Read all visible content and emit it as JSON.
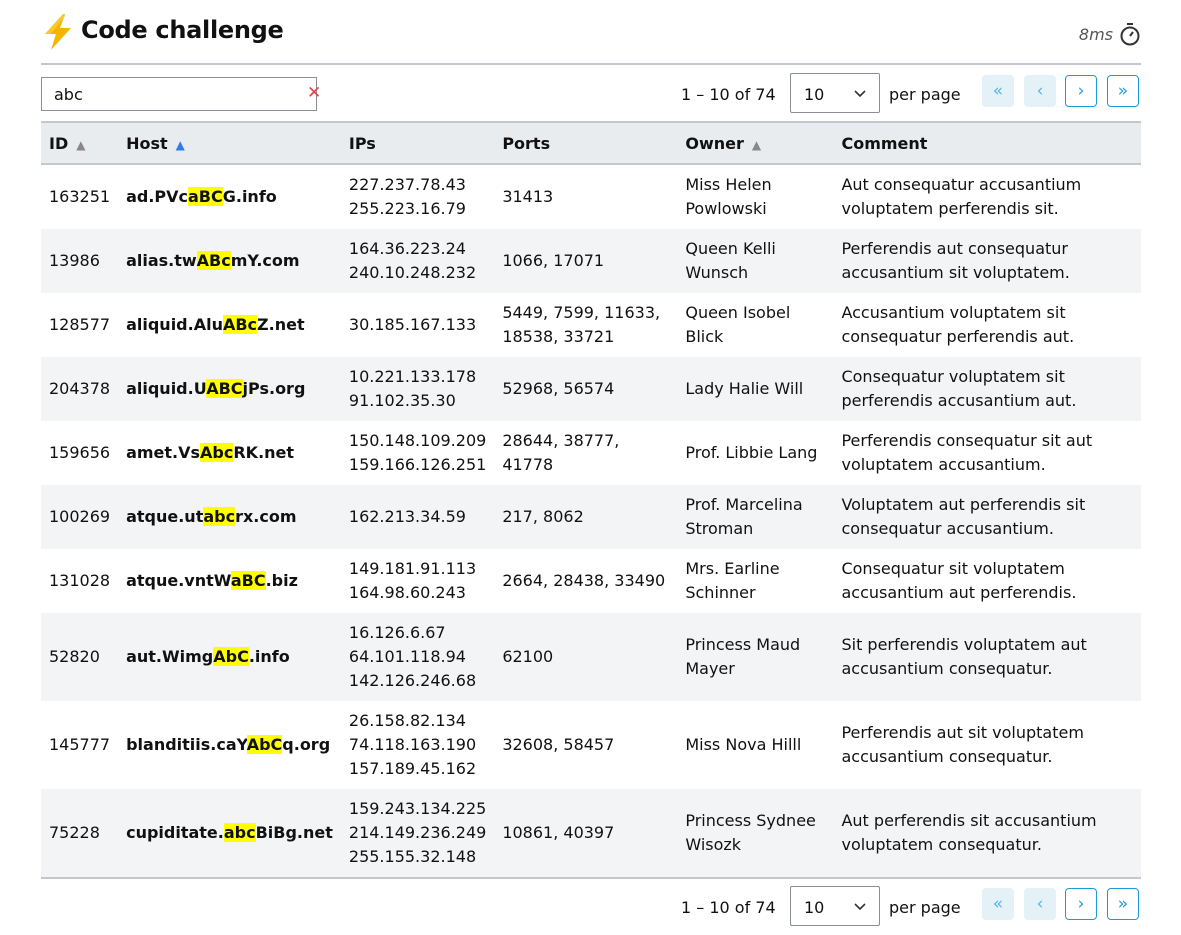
{
  "header": {
    "title": "Code challenge",
    "timing": "8ms"
  },
  "toolbar": {
    "search_value": "abc",
    "clear": "✕",
    "range": "1 – 10 of 74",
    "per_page_value": "10",
    "per_page_label": "per page",
    "first": "«",
    "prev": "‹",
    "next": "›",
    "last": "»"
  },
  "columns": [
    "ID",
    "Host",
    "IPs",
    "Ports",
    "Owner",
    "Comment"
  ],
  "rows": [
    {
      "id": "163251",
      "host_pre": "ad.PVc",
      "host_match": "aBC",
      "host_post": "G.info",
      "ips": [
        "227.237.78.43",
        "255.223.16.79"
      ],
      "ports": "31413",
      "owner": "Miss Helen Powlowski",
      "comment": "Aut consequatur accusantium voluptatem perferendis sit."
    },
    {
      "id": "13986",
      "host_pre": "alias.tw",
      "host_match": "ABc",
      "host_post": "mY.com",
      "ips": [
        "164.36.223.24",
        "240.10.248.232"
      ],
      "ports": "1066, 17071",
      "owner": "Queen Kelli Wunsch",
      "comment": "Perferendis aut consequatur accusantium sit voluptatem."
    },
    {
      "id": "128577",
      "host_pre": "aliquid.Alu",
      "host_match": "ABc",
      "host_post": "Z.net",
      "ips": [
        "30.185.167.133"
      ],
      "ports": "5449, 7599, 11633, 18538, 33721",
      "owner": "Queen Isobel Blick",
      "comment": "Accusantium voluptatem sit consequatur perferendis aut."
    },
    {
      "id": "204378",
      "host_pre": "aliquid.U",
      "host_match": "ABC",
      "host_post": "jPs.org",
      "ips": [
        "10.221.133.178",
        "91.102.35.30"
      ],
      "ports": "52968, 56574",
      "owner": "Lady Halie Will",
      "comment": "Consequatur voluptatem sit perferendis accusantium aut."
    },
    {
      "id": "159656",
      "host_pre": "amet.Vs",
      "host_match": "Abc",
      "host_post": "RK.net",
      "ips": [
        "150.148.109.209",
        "159.166.126.251"
      ],
      "ports": "28644, 38777, 41778",
      "owner": "Prof. Libbie Lang",
      "comment": "Perferendis consequatur sit aut voluptatem accusantium."
    },
    {
      "id": "100269",
      "host_pre": "atque.ut",
      "host_match": "abc",
      "host_post": "rx.com",
      "ips": [
        "162.213.34.59"
      ],
      "ports": "217, 8062",
      "owner": "Prof. Marcelina Stroman",
      "comment": "Voluptatem aut perferendis sit consequatur accusantium."
    },
    {
      "id": "131028",
      "host_pre": "atque.vntW",
      "host_match": "aBC",
      "host_post": ".biz",
      "ips": [
        "149.181.91.113",
        "164.98.60.243"
      ],
      "ports": "2664, 28438, 33490",
      "owner": "Mrs. Earline Schinner",
      "comment": "Consequatur sit voluptatem accusantium aut perferendis."
    },
    {
      "id": "52820",
      "host_pre": "aut.Wimg",
      "host_match": "AbC",
      "host_post": ".info",
      "ips": [
        "16.126.6.67",
        "64.101.118.94",
        "142.126.246.68"
      ],
      "ports": "62100",
      "owner": "Princess Maud Mayer",
      "comment": "Sit perferendis voluptatem aut accusantium consequatur."
    },
    {
      "id": "145777",
      "host_pre": "blanditiis.caY",
      "host_match": "AbC",
      "host_post": "q.org",
      "ips": [
        "26.158.82.134",
        "74.118.163.190",
        "157.189.45.162"
      ],
      "ports": "32608, 58457",
      "owner": "Miss Nova Hilll",
      "comment": "Perferendis aut sit voluptatem accusantium consequatur."
    },
    {
      "id": "75228",
      "host_pre": "cupiditate.",
      "host_match": "abc",
      "host_post": "BiBg.net",
      "ips": [
        "159.243.134.225",
        "214.149.236.249",
        "255.155.32.148"
      ],
      "ports": "10861, 40397",
      "owner": "Princess Sydnee Wisozk",
      "comment": "Aut perferendis sit accusantium voluptatem consequatur."
    }
  ],
  "colors": {
    "highlight": "#ffff00",
    "accent": "#1d9bd6",
    "sort_active": "#2f7bea",
    "clear": "#e0414b"
  },
  "icons": {
    "title": "lightning-bolt-icon",
    "timing": "stopwatch-icon"
  }
}
